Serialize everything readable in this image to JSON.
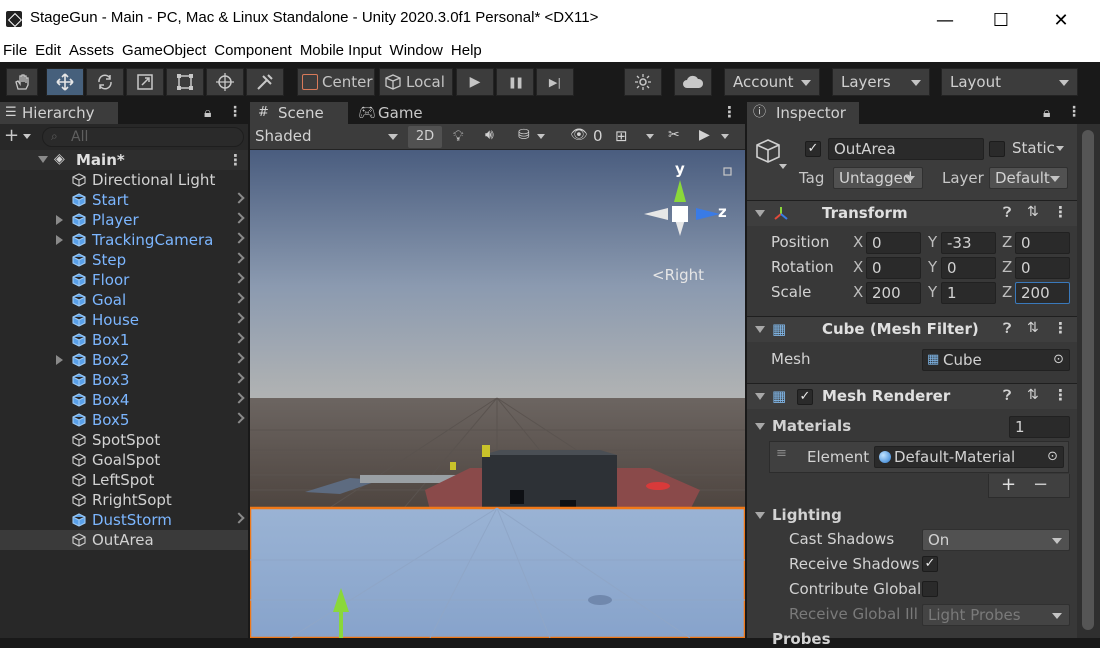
{
  "window": {
    "title": "StageGun - Main - PC, Mac & Linux Standalone - Unity 2020.3.0f1 Personal* <DX11>",
    "minimize": "—",
    "maximize": "☐",
    "close": "✕"
  },
  "menu": [
    "File",
    "Edit",
    "Assets",
    "GameObject",
    "Component",
    "Mobile Input",
    "Window",
    "Help"
  ],
  "toolbar": {
    "tools": [
      "hand-icon",
      "move-icon",
      "rotate-icon",
      "scale-icon",
      "rect-icon",
      "transform-icon",
      "custom-tool-icon"
    ],
    "pivot_label": "Center",
    "space_label": "Local",
    "play": "▶",
    "pause": "❚❚",
    "step": "▶|",
    "account_label": "Account",
    "layers_label": "Layers",
    "layout_label": "Layout"
  },
  "hierarchy": {
    "tab_label": "Hierarchy",
    "search_placeholder": "All",
    "scene_name": "Main*",
    "items": [
      {
        "label": "Directional Light",
        "prefab": false,
        "children": false
      },
      {
        "label": "Start",
        "prefab": true,
        "children": true
      },
      {
        "label": "Player",
        "prefab": true,
        "children": true,
        "fold": true
      },
      {
        "label": "TrackingCamera",
        "prefab": true,
        "children": true,
        "fold": true
      },
      {
        "label": "Step",
        "prefab": true,
        "children": true
      },
      {
        "label": "Floor",
        "prefab": true,
        "children": true
      },
      {
        "label": "Goal",
        "prefab": true,
        "children": true
      },
      {
        "label": "House",
        "prefab": true,
        "children": true
      },
      {
        "label": "Box1",
        "prefab": true,
        "children": true
      },
      {
        "label": "Box2",
        "prefab": true,
        "children": true,
        "fold": true
      },
      {
        "label": "Box3",
        "prefab": true,
        "children": true
      },
      {
        "label": "Box4",
        "prefab": true,
        "children": true
      },
      {
        "label": "Box5",
        "prefab": true,
        "children": true
      },
      {
        "label": "SpotSpot",
        "prefab": false,
        "children": false
      },
      {
        "label": "GoalSpot",
        "prefab": false,
        "children": false
      },
      {
        "label": "LeftSpot",
        "prefab": false,
        "children": false
      },
      {
        "label": "RrightSopt",
        "prefab": false,
        "children": false
      },
      {
        "label": "DustStorm",
        "prefab": true,
        "children": true
      },
      {
        "label": "OutArea",
        "prefab": false,
        "children": false,
        "selected": true
      }
    ]
  },
  "scene": {
    "scene_tab": "Scene",
    "game_tab": "Game",
    "shading_mode": "Shaded",
    "mode_2d": "2D",
    "hidden_count": "0",
    "gizmo_y": "y",
    "gizmo_z": "z",
    "view_label": "<Right"
  },
  "inspector": {
    "tab_label": "Inspector",
    "object_name": "OutArea",
    "static_label": "Static",
    "tag_label": "Tag",
    "tag_value": "Untagged",
    "layer_label": "Layer",
    "layer_value": "Default",
    "transform": {
      "title": "Transform",
      "position_label": "Position",
      "rotation_label": "Rotation",
      "scale_label": "Scale",
      "position": {
        "x": "0",
        "y": "-33",
        "z": "0"
      },
      "rotation": {
        "x": "0",
        "y": "0",
        "z": "0"
      },
      "scale": {
        "x": "200",
        "y": "1",
        "z": "200"
      }
    },
    "mesh_filter": {
      "title": "Cube (Mesh Filter)",
      "mesh_label": "Mesh",
      "mesh_value": "Cube"
    },
    "mesh_renderer": {
      "title": "Mesh Renderer",
      "materials_label": "Materials",
      "materials_count": "1",
      "element_label": "Element (",
      "element_value": "Default-Material",
      "add": "+",
      "remove": "−",
      "lighting_label": "Lighting",
      "cast_shadows_label": "Cast Shadows",
      "cast_shadows_value": "On",
      "receive_shadows_label": "Receive Shadows",
      "contribute_gi_label": "Contribute Global",
      "receive_gi_label": "Receive Global Illu",
      "receive_gi_value": "Light Probes",
      "probes_label": "Probes"
    }
  },
  "colors": {
    "accent": "#46607c",
    "selection_outline": "#f07818",
    "prefab_blue": "#7cb6ff"
  }
}
